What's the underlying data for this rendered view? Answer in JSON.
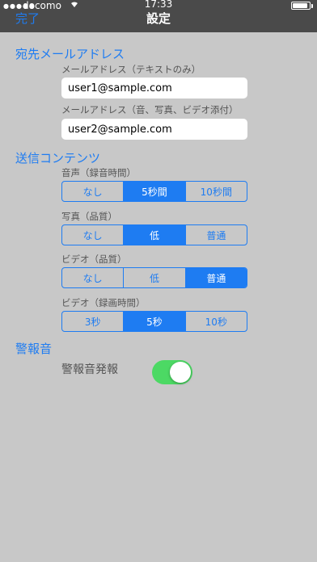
{
  "status": {
    "carrier": "docomo",
    "time": "17:33"
  },
  "nav": {
    "done": "完了",
    "title": "設定"
  },
  "email": {
    "section": "宛先メールアドレス",
    "text_label": "メールアドレス（テキストのみ）",
    "text_value": "user1@sample.com",
    "media_label": "メールアドレス（音、写真、ビデオ添付）",
    "media_value": "user2@sample.com"
  },
  "content": {
    "section": "送信コンテンツ",
    "groups": [
      {
        "label": "音声（録音時間）",
        "options": [
          "なし",
          "5秒間",
          "10秒間"
        ],
        "selected": 1
      },
      {
        "label": "写真（品質）",
        "options": [
          "なし",
          "低",
          "普通"
        ],
        "selected": 1
      },
      {
        "label": "ビデオ（品質）",
        "options": [
          "なし",
          "低",
          "普通"
        ],
        "selected": 2
      },
      {
        "label": "ビデオ（録画時間）",
        "options": [
          "3秒",
          "5秒",
          "10秒"
        ],
        "selected": 1
      }
    ]
  },
  "alarm": {
    "section": "警報音",
    "label": "警報音発報",
    "on": true
  },
  "colors": {
    "accent": "#1e7cf2",
    "switch_on": "#4cd964",
    "navbar": "#4a4a4a",
    "background": "#c8c8c8"
  }
}
